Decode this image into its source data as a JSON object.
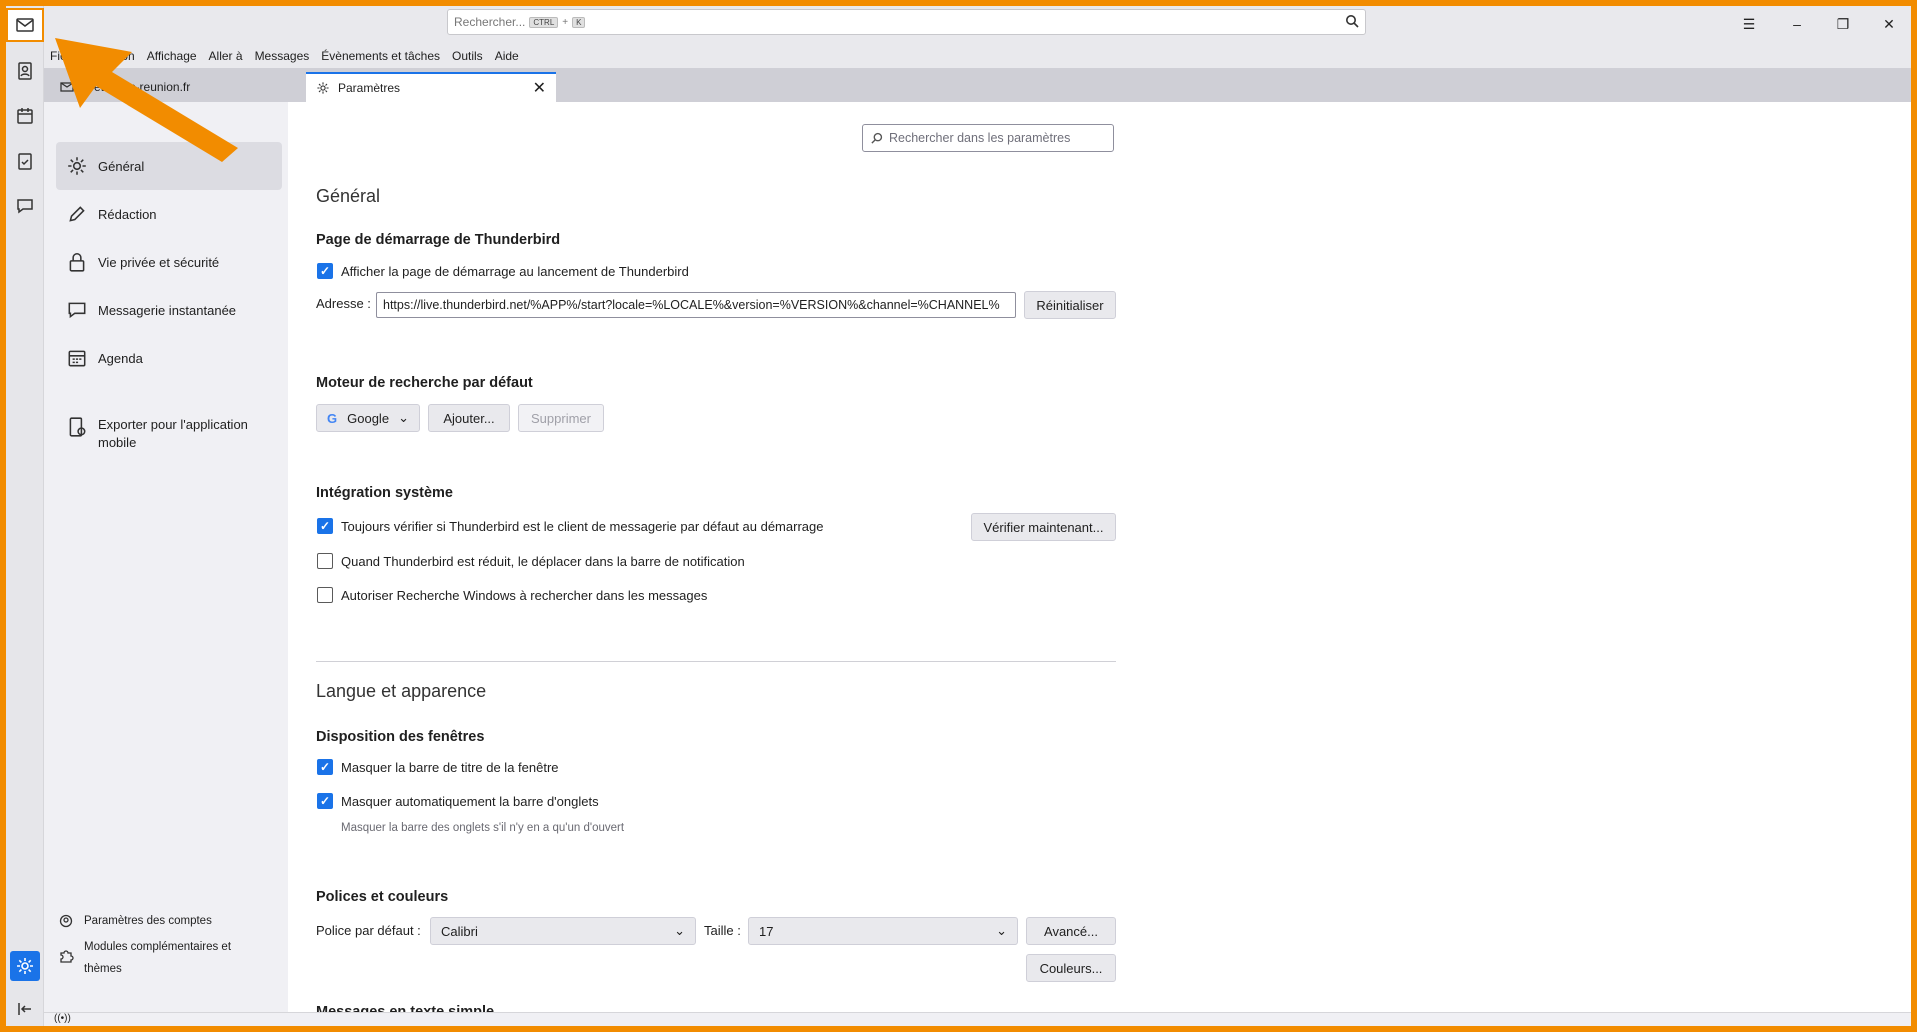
{
  "topbar": {
    "search_placeholder": "Rechercher...",
    "shortcut_ctrl": "CTRL",
    "shortcut_plus": "+",
    "shortcut_key": "K"
  },
  "menu": [
    "Fichier",
    "Édition",
    "Affichage",
    "Aller à",
    "Messages",
    "Évènements et tâches",
    "Outils",
    "Aide"
  ],
  "tabs": {
    "mail_label": "…ete@ac-reunion.fr",
    "settings_label": "Paramètres"
  },
  "sidebar": {
    "categories": [
      "Général",
      "Rédaction",
      "Vie privée et sécurité",
      "Messagerie instantanée",
      "Agenda"
    ],
    "export_line1": "Exporter pour l'application",
    "export_line2": "mobile",
    "accounts_link": "Paramètres des comptes",
    "addons_line1": "Modules complémentaires et",
    "addons_line2": "thèmes"
  },
  "main": {
    "search_placeholder": "Rechercher dans les paramètres",
    "general_title": "Général",
    "startup": {
      "title": "Page de démarrage de Thunderbird",
      "checkbox_label": "Afficher la page de démarrage au lancement de Thunderbird",
      "address_label": "Adresse :",
      "address_value": "https://live.thunderbird.net/%APP%/start?locale=%LOCALE%&version=%VERSION%&channel=%CHANNEL%",
      "reset_button": "Réinitialiser"
    },
    "search_engine": {
      "title": "Moteur de recherche par défaut",
      "engine": "Google",
      "add_button": "Ajouter...",
      "remove_button": "Supprimer"
    },
    "system": {
      "title": "Intégration système",
      "check_default": "Toujours vérifier si Thunderbird est le client de messagerie par défaut au démarrage",
      "verify_button": "Vérifier maintenant...",
      "minimize_tray": "Quand Thunderbird est réduit, le déplacer dans la barre de notification",
      "windows_search": "Autoriser Recherche Windows à rechercher dans les messages"
    },
    "language_title": "Langue et apparence",
    "layout": {
      "title": "Disposition des fenêtres",
      "hide_titlebar": "Masquer la barre de titre de la fenêtre",
      "autohide_tabs": "Masquer automatiquement la barre d'onglets",
      "autohide_hint": "Masquer la barre des onglets s'il n'y en a qu'un d'ouvert"
    },
    "fonts": {
      "title": "Polices et couleurs",
      "default_font_label": "Police par défaut :",
      "default_font": "Calibri",
      "size_label": "Taille :",
      "size": "17",
      "advanced_button": "Avancé...",
      "colors_button": "Couleurs..."
    },
    "plain_text_title": "Messages en texte simple"
  },
  "colors": {
    "accent": "#1a73e8",
    "highlight": "#f28c00"
  },
  "checkbox_states": {
    "startup": true,
    "check_default": true,
    "minimize_tray": false,
    "windows_search": false,
    "hide_titlebar": true,
    "autohide_tabs": true
  }
}
